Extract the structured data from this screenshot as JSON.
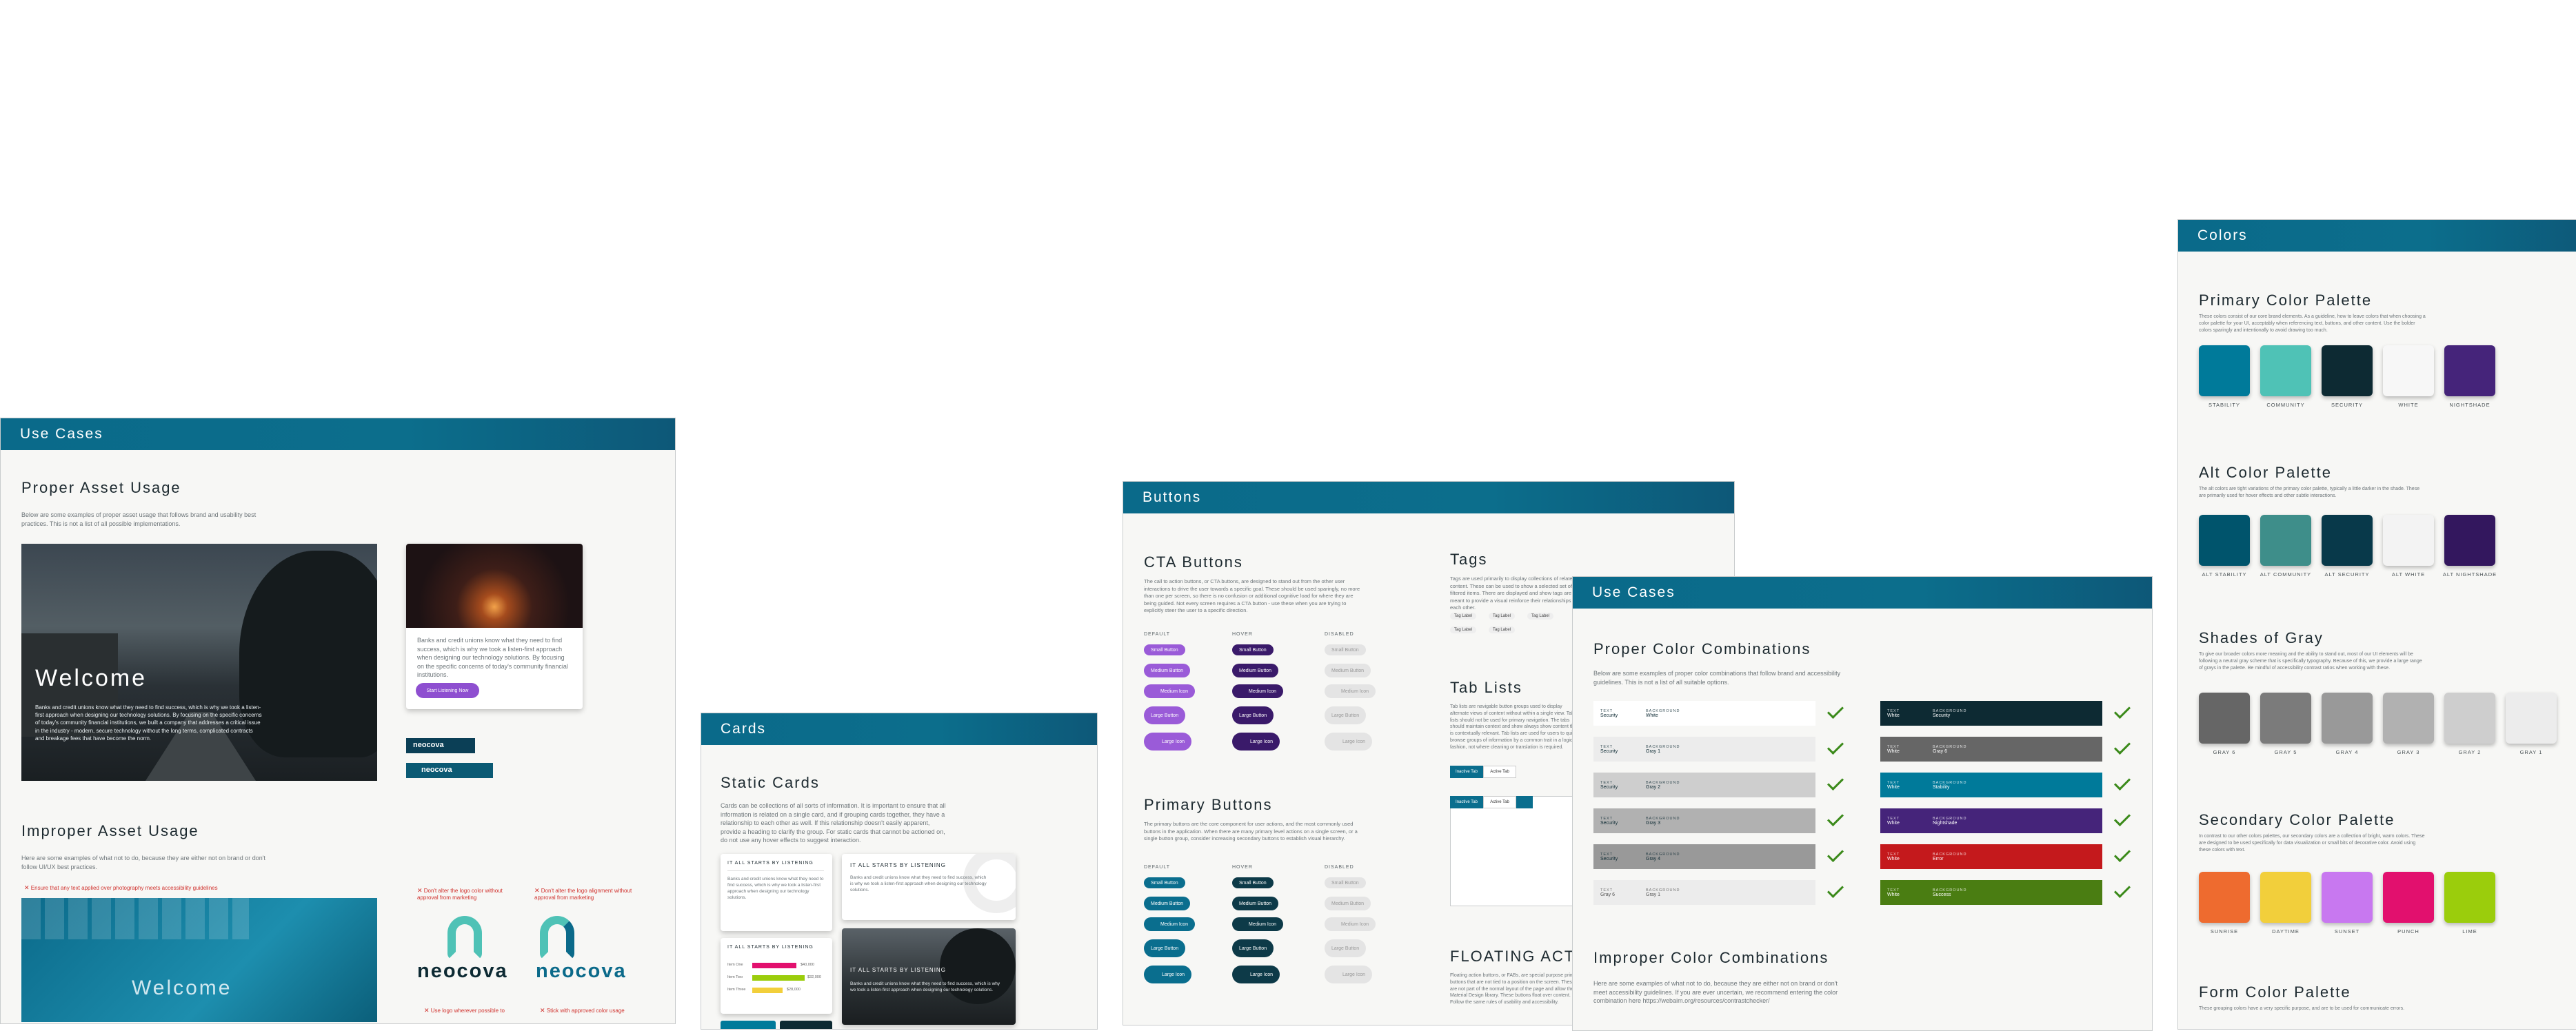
{
  "colors_board": {
    "header": "Colors",
    "primary": {
      "title": "Primary Color Palette",
      "desc": "These colors consist of our core brand elements. As a guideline, how to leave colors that when choosing a color palette for your UI, acceptably when referencing text, buttons, and other content. Use the bolder colors sparingly and intentionally to avoid drawing too much.",
      "swatches": [
        {
          "label": "STABILITY",
          "color": "#007a9a"
        },
        {
          "label": "COMMUNITY",
          "color": "#4fc2b6"
        },
        {
          "label": "SECURITY",
          "color": "#0d2a33"
        },
        {
          "label": "WHITE",
          "color": "#f7f7f7"
        },
        {
          "label": "NIGHTSHADE",
          "color": "#45247a"
        }
      ]
    },
    "alt": {
      "title": "Alt Color Palette",
      "desc": "The alt colors are tight variations of the primary color palette, typically a little darker in the shade. These are primarily used for hover effects and other subtle interactions.",
      "swatches": [
        {
          "label": "ALT STABILITY",
          "color": "#00546c"
        },
        {
          "label": "ALT COMMUNITY",
          "color": "#3e8e8a"
        },
        {
          "label": "ALT SECURITY",
          "color": "#08394a"
        },
        {
          "label": "ALT WHITE",
          "color": "#f3f3f3"
        },
        {
          "label": "ALT NIGHTSHADE",
          "color": "#33175e"
        }
      ]
    },
    "gray": {
      "title": "Shades of Gray",
      "desc": "To give our broader colors more meaning and the ability to stand out, most of our UI elements will be following a neutral gray scheme that is specifically typography. Because of this, we provide a large range of grays in the palette. Be mindful of accessibility contrast ratios when working with these.",
      "swatches": [
        {
          "label": "GRAY 6",
          "color": "#666666"
        },
        {
          "label": "GRAY 5",
          "color": "#7b7b7b"
        },
        {
          "label": "GRAY 4",
          "color": "#999999"
        },
        {
          "label": "GRAY 3",
          "color": "#b1b1b1"
        },
        {
          "label": "GRAY 2",
          "color": "#cecece"
        },
        {
          "label": "GRAY 1",
          "color": "#ececec"
        }
      ]
    },
    "secondary": {
      "title": "Secondary Color Palette",
      "desc": "In contrast to our other colors palettes, our secondary colors are a collection of bright, warm colors. These are designed to be used specifically for data visualization or small bits of decorative color. Avoid using these colors with text.",
      "swatches": [
        {
          "label": "SUNRISE",
          "color": "#ee6b2f"
        },
        {
          "label": "DAYTIME",
          "color": "#f2cf3b"
        },
        {
          "label": "SUNSET",
          "color": "#c878f0"
        },
        {
          "label": "PUNCH",
          "color": "#e2106e"
        },
        {
          "label": "LIME",
          "color": "#9bcd0c"
        }
      ]
    },
    "form": {
      "title": "Form Color Palette",
      "desc": "These grouping colors have a very specific purpose, and are to be used for communicate errors."
    }
  },
  "usecases_board": {
    "header": "Use Cases",
    "proper": {
      "title": "Proper Asset Usage",
      "desc": "Below are some examples of proper asset usage that follows brand and usability best practices. This is not a list of all possible implementations.",
      "hero_title": "Welcome",
      "hero_text": "Banks and credit unions know what they need to find success, which is why we took a listen-first approach when designing our technology solutions. By focusing on the specific concerns of today's community financial institutions, we built a company that addresses a critical issue in the industry - modern, secure technology without the long terms, complicated contracts and breakage fees that have become the norm.",
      "card_text": "Banks and credit unions know what they need to find success, which is why we took a listen-first approach when designing our technology solutions. By focusing on the specific concerns of today's community financial institutions.",
      "card_button": "Start Listening Now",
      "logo_text": "neocova"
    },
    "improper": {
      "title": "Improper Asset Usage",
      "desc": "Here are some examples of what not to do, because they are either not on brand or don't follow UI/UX best practices.",
      "rule1": "Ensure that any text applied over photography meets accessibility guidelines",
      "rule2": "Don't alter the logo color without approval from marketing",
      "rule3": "Don't alter the logo alignment without approval from marketing",
      "rule4": "Use logo wherever possible to",
      "rule5": "Stick with approved color usage",
      "hero_title": "Welcome",
      "logo_text": "neocova"
    }
  },
  "cards_board": {
    "header": "Cards",
    "static": {
      "title": "Static Cards",
      "desc": "Cards can be collections of all sorts of information. It is important to ensure that all information is related on a single card, and if grouping cards together, they have a relationship to each other as well. If this relationship doesn't easily apparent, provide a heading to clarify the group. For static cards that cannot be actioned on, do not use any hover effects to suggest interaction.",
      "card_heading": "IT ALL STARTS BY LISTENING",
      "card_text": "Banks and credit unions know what they need to find success, which is why we took a listen-first approach when designing our technology solutions.",
      "bars": [
        "Item One",
        "Item Two",
        "Item Three"
      ],
      "bar_values": [
        "$40,000",
        "$32,000",
        "$28,000"
      ]
    }
  },
  "buttons_board": {
    "header": "Buttons",
    "cta": {
      "title": "CTA  Buttons",
      "desc": "The call to action buttons, or CTA buttons, are designed to stand out from the other user interactions to drive the user towards a specific goal. These should be used sparingly, no more than one per screen, so there is no confusion or additional cognitive load for where they are being guided. Not every screen requires a CTA button - use these when you are trying to explicitly steer the user to a specific direction.",
      "col_default": "DEFAULT",
      "col_hover": "HOVER",
      "col_disabled": "DISABLED",
      "buttons": [
        "Small Button",
        "Medium Button",
        "Medium Icon",
        "Large Button",
        "Large Icon"
      ]
    },
    "primary": {
      "title": "Primary  Buttons",
      "desc": "The primary buttons are the core component for user actions, and the most commonly used buttons in the application. When there are many primary level actions on a single screen, or a single button group, consider increasing secondary buttons to establish visual hierarchy.",
      "col_default": "DEFAULT",
      "col_hover": "HOVER",
      "col_disabled": "DISABLED",
      "buttons": [
        "Small Button",
        "Medium Button",
        "Medium Icon",
        "Large Button",
        "Large Icon"
      ]
    },
    "tags": {
      "title": "Tags",
      "desc": "Tags are used primarily to display collections of related content. These can be used to show a selected set of filtered items. There are displayed and show tags are meant to provide a visual reinforce their relationships to each other.",
      "tag_label": "Tag Label"
    },
    "tablists": {
      "title": "Tab Lists",
      "desc": "Tab lists are navigable button groups used to display alternate views of content without within a single view. Tab lists should not be used for primary navigation. The tabs should maintain context and show always show content that is contextually relevant. Tab lists are used for users to quickly browse groups of information by a common trait in a logical fashion, not where cleaning or translation is required.",
      "tab_inactive": "Inactive Tab",
      "tab_active": "Active Tab"
    },
    "floating": {
      "title": "FLOATING ACTI",
      "desc": "Floating action buttons, or FABs, are special purpose primary buttons that are not tied to a position on the screen. These are not part of the normal layout of the page and allow the Material Design library. These buttons float over content. Follow the same rules of usability and accessibility."
    }
  },
  "colorcombo_board": {
    "header": "Use Cases",
    "proper": {
      "title": "Proper Color Combinations",
      "desc": "Below are some examples of proper color combinations that follow brand and accessibility guidelines. This is not a list of all suitable options.",
      "text_label": "TEXT",
      "bg_label": "BACKGROUND",
      "left": [
        {
          "text": "Security",
          "bg": "White",
          "bgcolor": "#ffffff",
          "fg": "#0d2a33"
        },
        {
          "text": "Security",
          "bg": "Gray 1",
          "bgcolor": "#ececec",
          "fg": "#0d2a33"
        },
        {
          "text": "Security",
          "bg": "Gray 2",
          "bgcolor": "#cecece",
          "fg": "#0d2a33"
        },
        {
          "text": "Security",
          "bg": "Gray 3",
          "bgcolor": "#b1b1b1",
          "fg": "#0d2a33"
        },
        {
          "text": "Security",
          "bg": "Gray 4",
          "bgcolor": "#999999",
          "fg": "#0d2a33"
        },
        {
          "text": "Gray 6",
          "bg": "Gray 1",
          "bgcolor": "#ececec",
          "fg": "#555555"
        }
      ],
      "right": [
        {
          "text": "White",
          "bg": "Security",
          "bgcolor": "#0d2a33",
          "fg": "#ffffff"
        },
        {
          "text": "White",
          "bg": "Gray 6",
          "bgcolor": "#666666",
          "fg": "#ffffff"
        },
        {
          "text": "White",
          "bg": "Stability",
          "bgcolor": "#007a9a",
          "fg": "#ffffff"
        },
        {
          "text": "White",
          "bg": "Nightshade",
          "bgcolor": "#45247a",
          "fg": "#ffffff"
        },
        {
          "text": "White",
          "bg": "Error",
          "bgcolor": "#c4191c",
          "fg": "#ffffff"
        },
        {
          "text": "White",
          "bg": "Success",
          "bgcolor": "#4a7d12",
          "fg": "#ffffff"
        }
      ]
    },
    "improper": {
      "title": "Improper Color Combinations",
      "desc": "Here are some examples of what not to do, because they are either not on brand or don't meet accessibility guidelines. If you are ever uncertain, we recommend entering the color combination here https://webaim.org/resources/contrastchecker/"
    }
  }
}
